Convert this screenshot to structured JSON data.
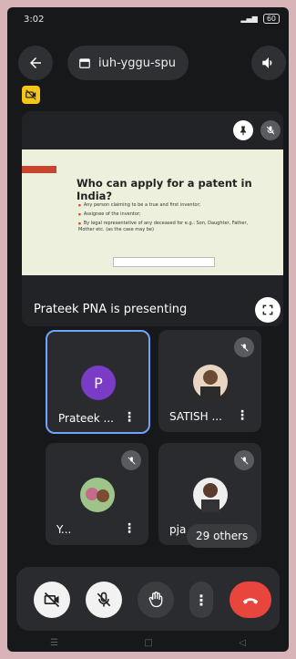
{
  "status": {
    "time": "3:02",
    "battery": "60"
  },
  "header": {
    "meeting_code": "iuh-yggu-spu"
  },
  "presentation": {
    "label": "Prateek PNA is presenting",
    "slide_title": "Who can apply for a patent in India?",
    "bullets": [
      "Any person claiming to be a true and first inventor;",
      "Assignee of the inventor;",
      "By legal representative of any deceased for e.g.: Son, Daughter, Father, Mother etc. (as the case may be)"
    ]
  },
  "participants": [
    {
      "name": "Prateek ...",
      "initial": "P"
    },
    {
      "name": "SATISH ..."
    },
    {
      "name": "Y..."
    },
    {
      "name": "pja"
    }
  ],
  "others_badge": "29 others",
  "colors": {
    "active_border": "#6fa3ff",
    "end_call": "#e8453c",
    "avatar_purple": "#7a3cc7",
    "badge_yellow": "#f5c518"
  },
  "icons": [
    "back-arrow-icon",
    "calendar-icon",
    "speaker-icon",
    "camera-off-icon",
    "pin-icon",
    "mic-off-icon",
    "fullscreen-icon",
    "hand-icon",
    "more-vert-icon",
    "hang-up-icon"
  ]
}
